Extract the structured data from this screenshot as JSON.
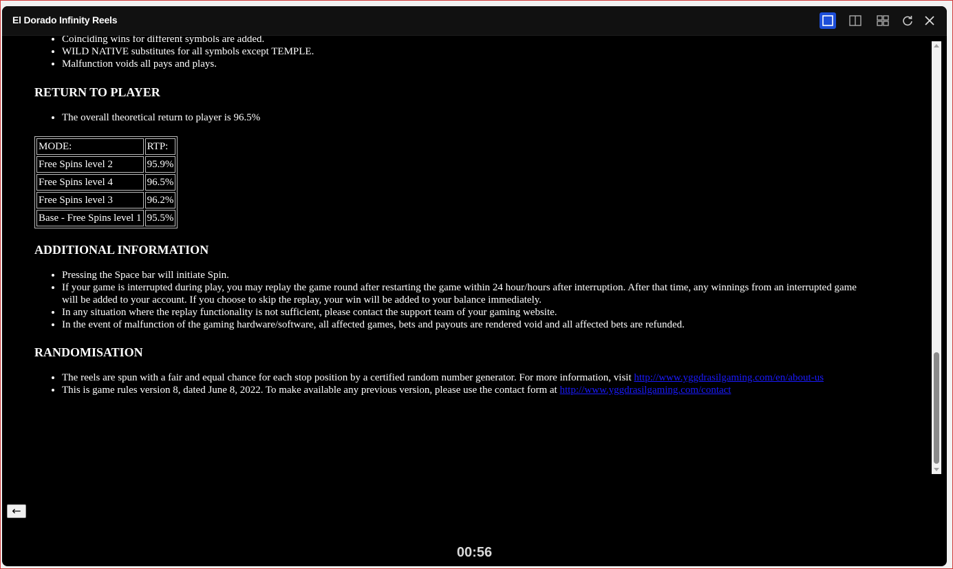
{
  "window": {
    "title": "El Dorado Infinity Reels"
  },
  "toolbar": {
    "icons": [
      "single-view-icon",
      "split-view-icon",
      "grid-view-icon",
      "reload-icon",
      "close-icon"
    ],
    "accent_color": "#1d4ed8"
  },
  "rules": {
    "top_list": [
      "Coinciding wins for different symbols are added.",
      "WILD NATIVE substitutes for all symbols except TEMPLE.",
      "Malfunction voids all pays and plays."
    ],
    "rtp": {
      "heading": "RETURN TO PLAYER",
      "text": "The overall theoretical return to player is 96.5%",
      "table": {
        "headers": [
          "MODE:",
          "RTP:"
        ],
        "rows": [
          [
            "Free Spins level 2",
            "95.9%"
          ],
          [
            "Free Spins level 4",
            "96.5%"
          ],
          [
            "Free Spins level 3",
            "96.2%"
          ],
          [
            "Base - Free Spins level 1",
            "95.5%"
          ]
        ]
      }
    },
    "additional": {
      "heading": "ADDITIONAL INFORMATION",
      "items": [
        "Pressing the Space bar will initiate Spin.",
        "If your game is interrupted during play, you may replay the game round after restarting the game within 24 hour/hours after interruption. After that time, any winnings from an interrupted game will be added to your account. If you choose to skip the replay, your win will be added to your balance immediately.",
        "In any situation where the replay functionality is not sufficient, please contact the support team of your gaming website.",
        "In the event of malfunction of the gaming hardware/software, all affected games, bets and payouts are rendered void and all affected bets are refunded."
      ]
    },
    "randomisation": {
      "heading": "RANDOMISATION",
      "item1_text": "The reels are spun with a fair and equal chance for each stop position by a certified random number generator. For more information, visit ",
      "item1_link": "http://www.yggdrasilgaming.com/en/about-us",
      "item2_text": "This is game rules version 8, dated June 8, 2022. To make available any previous version, please use the contact form at ",
      "item2_link": "http://www.yggdrasilgaming.com/contact"
    }
  },
  "back_button": {
    "label": "←"
  },
  "timer": {
    "value": "00:56"
  }
}
